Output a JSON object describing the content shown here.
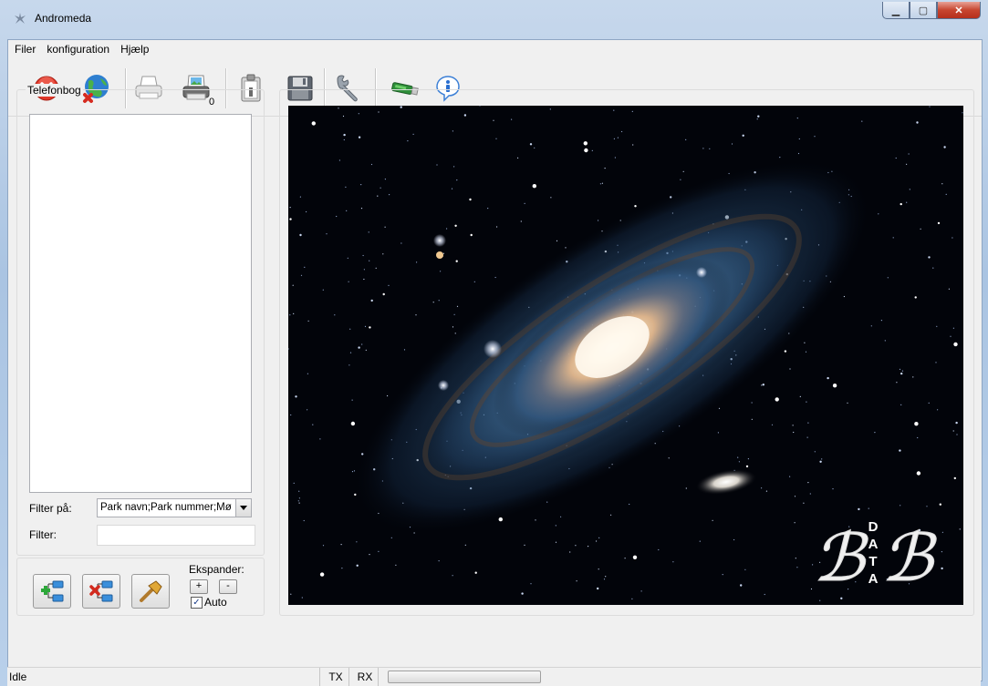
{
  "window": {
    "title": "Andromeda"
  },
  "menu": [
    "Filer",
    "konfiguration",
    "Hjælp"
  ],
  "toolbar": {
    "buttons": [
      "close-icon",
      "globe-connect-icon",
      "printer-icon",
      "print-preview-icon",
      "clipboard-icon",
      "save-disk-icon",
      "wrench-icon",
      "usb-stick-icon",
      "info-icon"
    ]
  },
  "phonebook": {
    "title": "Telefonbog",
    "count": "0",
    "filter_on_label": "Filter på:",
    "filter_on_value": "Park navn;Park nummer;Mø",
    "filter_label": "Filter:",
    "filter_value": ""
  },
  "actions": {
    "expand_label": "Ekspander:",
    "plus": "+",
    "minus": "-",
    "auto_label": "Auto",
    "auto_checked": "✓"
  },
  "logo": {
    "letters": "DATA",
    "mark": "ℬℬ"
  },
  "status": {
    "text": "Idle",
    "tx": "TX",
    "rx": "RX"
  },
  "colors": {
    "space": "#02040a",
    "galaxy_core": "#fff3d8",
    "arm": "#3a6a9a"
  }
}
